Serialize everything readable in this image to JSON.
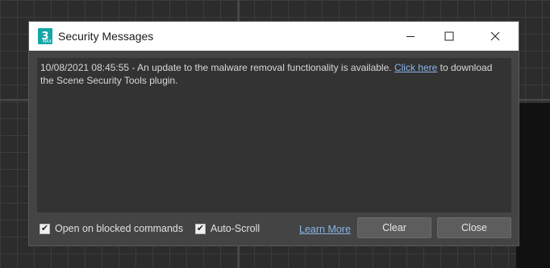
{
  "window": {
    "title": "Security Messages",
    "app_icon_label": "3",
    "app_icon_sublabel": "MAX"
  },
  "message": {
    "prefix": "10/08/2021 08:45:55 - An update to the malware removal functionality is available. ",
    "link_text": "Click here",
    "suffix": " to download the Scene Security Tools plugin."
  },
  "footer": {
    "open_on_blocked_label": "Open on blocked commands",
    "open_on_blocked_checked": true,
    "auto_scroll_label": "Auto-Scroll",
    "auto_scroll_checked": true,
    "learn_more_label": "Learn More",
    "clear_label": "Clear",
    "close_label": "Close"
  },
  "icons": {
    "app": "3ds-max-icon",
    "minimize": "minimize-icon",
    "maximize": "maximize-icon",
    "close": "close-icon",
    "check": "checkmark-icon"
  },
  "colors": {
    "link": "#8ab4ea",
    "dialog_bg": "#444444",
    "message_bg": "#333333",
    "app_icon": "#16a6a8"
  }
}
